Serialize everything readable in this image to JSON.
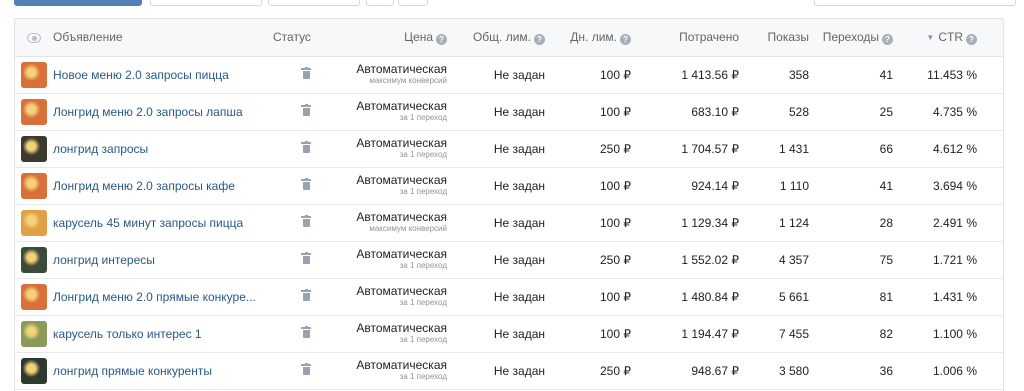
{
  "columns": {
    "status": "Статус",
    "price": "Цена",
    "total_limit": "Общ. лим.",
    "daily_limit": "Дн. лим.",
    "spent": "Потрачено",
    "impressions": "Показы",
    "clicks": "Переходы",
    "ctr": "CTR",
    "ad": "Объявление"
  },
  "rows": [
    {
      "name": "Новое меню 2.0 запросы пицца",
      "price": "Автоматическая",
      "price_sub": "максимум конверсий",
      "total_limit": "Не задан",
      "daily_limit": "100 ₽",
      "spent": "1 413.56 ₽",
      "impressions": "358",
      "clicks": "41",
      "ctr": "11.453 %",
      "thumb_color": "#d9703a"
    },
    {
      "name": "Лонгрид меню 2.0 запросы лапша",
      "price": "Автоматическая",
      "price_sub": "за 1 переход",
      "total_limit": "Не задан",
      "daily_limit": "100 ₽",
      "spent": "683.10 ₽",
      "impressions": "528",
      "clicks": "25",
      "ctr": "4.735 %",
      "thumb_color": "#d9703a"
    },
    {
      "name": "лонгрид запросы",
      "price": "Автоматическая",
      "price_sub": "за 1 переход",
      "total_limit": "Не задан",
      "daily_limit": "250 ₽",
      "spent": "1 704.57 ₽",
      "impressions": "1 431",
      "clicks": "66",
      "ctr": "4.612 %",
      "thumb_color": "#3a3a2e"
    },
    {
      "name": "Лонгрид меню 2.0 запросы кафе",
      "price": "Автоматическая",
      "price_sub": "за 1 переход",
      "total_limit": "Не задан",
      "daily_limit": "100 ₽",
      "spent": "924.14 ₽",
      "impressions": "1 110",
      "clicks": "41",
      "ctr": "3.694 %",
      "thumb_color": "#d9703a"
    },
    {
      "name": "карусель 45 минут запросы пицца",
      "price": "Автоматическая",
      "price_sub": "максимум конверсий",
      "total_limit": "Не задан",
      "daily_limit": "100 ₽",
      "spent": "1 129.34 ₽",
      "impressions": "1 124",
      "clicks": "28",
      "ctr": "2.491 %",
      "thumb_color": "#e0a045"
    },
    {
      "name": "лонгрид интересы",
      "price": "Автоматическая",
      "price_sub": "за 1 переход",
      "total_limit": "Не задан",
      "daily_limit": "250 ₽",
      "spent": "1 552.02 ₽",
      "impressions": "4 357",
      "clicks": "75",
      "ctr": "1.721 %",
      "thumb_color": "#3c4a38"
    },
    {
      "name": "Лонгрид меню 2.0 прямые конкуре...",
      "price": "Автоматическая",
      "price_sub": "за 1 переход",
      "total_limit": "Не задан",
      "daily_limit": "100 ₽",
      "spent": "1 480.84 ₽",
      "impressions": "5 661",
      "clicks": "81",
      "ctr": "1.431 %",
      "thumb_color": "#d9703a"
    },
    {
      "name": "карусель только интерес 1",
      "price": "Автоматическая",
      "price_sub": "за 1 переход",
      "total_limit": "Не задан",
      "daily_limit": "100 ₽",
      "spent": "1 194.47 ₽",
      "impressions": "7 455",
      "clicks": "82",
      "ctr": "1.100 %",
      "thumb_color": "#8a9a5a"
    },
    {
      "name": "лонгрид прямые конкуренты",
      "price": "Автоматическая",
      "price_sub": "за 1 переход",
      "total_limit": "Не задан",
      "daily_limit": "250 ₽",
      "spent": "948.67 ₽",
      "impressions": "3 580",
      "clicks": "36",
      "ctr": "1.006 %",
      "thumb_color": "#2f3a2c"
    }
  ],
  "icons": {
    "visibility": "eye-icon",
    "help": "help-icon",
    "delete": "trash-icon",
    "sort": "sort-desc-icon"
  },
  "colors": {
    "link": "#2a5885",
    "header_bg": "#f7f8fa",
    "primary_button": "#5181b8"
  }
}
